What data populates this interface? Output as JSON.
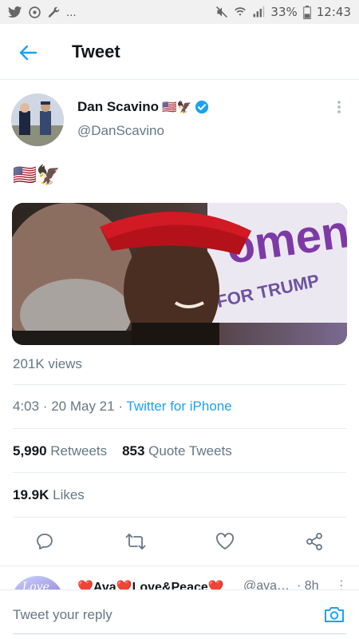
{
  "status_bar": {
    "battery": "33%",
    "time": "12:43",
    "overflow": "..."
  },
  "header": {
    "title": "Tweet"
  },
  "author": {
    "name": "Dan Scavino",
    "name_emoji": "🇺🇸🦅",
    "handle": "@DanScavino"
  },
  "tweet": {
    "text": "🇺🇸🦅"
  },
  "media": {
    "sign_text_1": "omen",
    "sign_text_2": "FOR TRUMP"
  },
  "views": "201K views",
  "meta": {
    "time": "4:03",
    "separator": " · ",
    "date": "20 May 21",
    "source": "Twitter for iPhone"
  },
  "stats": {
    "retweets_count": "5,990",
    "retweets_label": "Retweets",
    "quotes_count": "853",
    "quotes_label": "Quote Tweets",
    "likes_count": "19.9K",
    "likes_label": "Likes"
  },
  "reply_preview": {
    "name": "❤️Ava❤️Love&Peace❤️",
    "handle": "@ava…",
    "time": "· 8h",
    "more": "⋮",
    "avatar_text": "Love"
  },
  "reply_bar": {
    "placeholder": "Tweet your reply"
  },
  "colors": {
    "accent": "#1da1f2",
    "verified": "#1da1f2",
    "secondary_text": "#657786"
  }
}
